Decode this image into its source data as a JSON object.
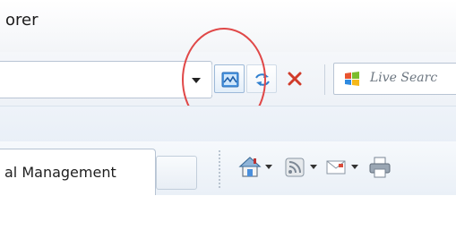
{
  "window": {
    "title_fragment": "orer"
  },
  "address_bar": {
    "url": "",
    "dropdown_icon": "chevron-down-icon",
    "compatibility_icon": "compatibility-view-icon",
    "refresh_icon": "refresh-icon",
    "stop_icon": "stop-icon"
  },
  "search": {
    "placeholder": "Live Search",
    "visible_text": "Live Searc",
    "logo_icon": "live-search-logo-icon"
  },
  "tabs": [
    {
      "label": "al Management",
      "active": true
    }
  ],
  "command_bar": {
    "home_icon": "home-icon",
    "feeds_icon": "feeds-icon",
    "mail_icon": "mail-icon",
    "print_icon": "print-icon"
  },
  "annotation": {
    "highlight_color": "#e04848"
  },
  "colors": {
    "chrome_bg": "#eef2f7",
    "border": "#b8c4d4",
    "accent_blue": "#3a86d6",
    "stop_red": "#d03b2a"
  }
}
